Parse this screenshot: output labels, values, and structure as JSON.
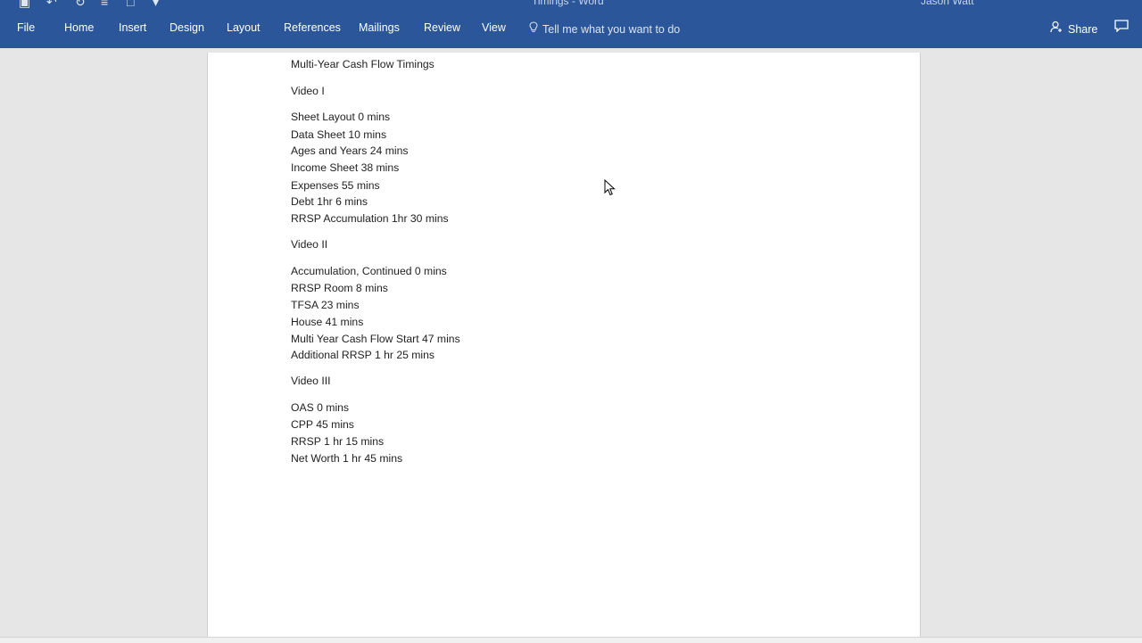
{
  "window": {
    "title": "Timings - Word",
    "user": "Jason Watt"
  },
  "ribbon": {
    "tabs": [
      "File",
      "Home",
      "Insert",
      "Design",
      "Layout",
      "References",
      "Mailings",
      "Review",
      "View"
    ],
    "tell_me": "Tell me what you want to do",
    "share": "Share",
    "colors": {
      "ribbon_bg": "#2b579a",
      "text": "#ffffff"
    }
  },
  "document": {
    "lines": [
      "Multi-Year Cash Flow Timings",
      "Video I",
      "Sheet Layout 0 mins",
      "Data Sheet 10 mins",
      "Ages and Years 24 mins",
      "Income Sheet 38 mins",
      "Expenses 55 mins",
      "Debt 1hr 6 mins",
      "RRSP Accumulation 1hr 30 mins",
      "Video II",
      "Accumulation, Continued 0 mins",
      "RRSP Room 8 mins",
      "TFSA 23 mins",
      "House 41 mins",
      "Multi Year Cash Flow Start 47 mins",
      "Additional RRSP 1 hr 25 mins",
      "Video III",
      "OAS 0 mins",
      "CPP 45 mins",
      "RRSP 1 hr 15 mins",
      "Net Worth 1 hr 45 mins"
    ]
  }
}
